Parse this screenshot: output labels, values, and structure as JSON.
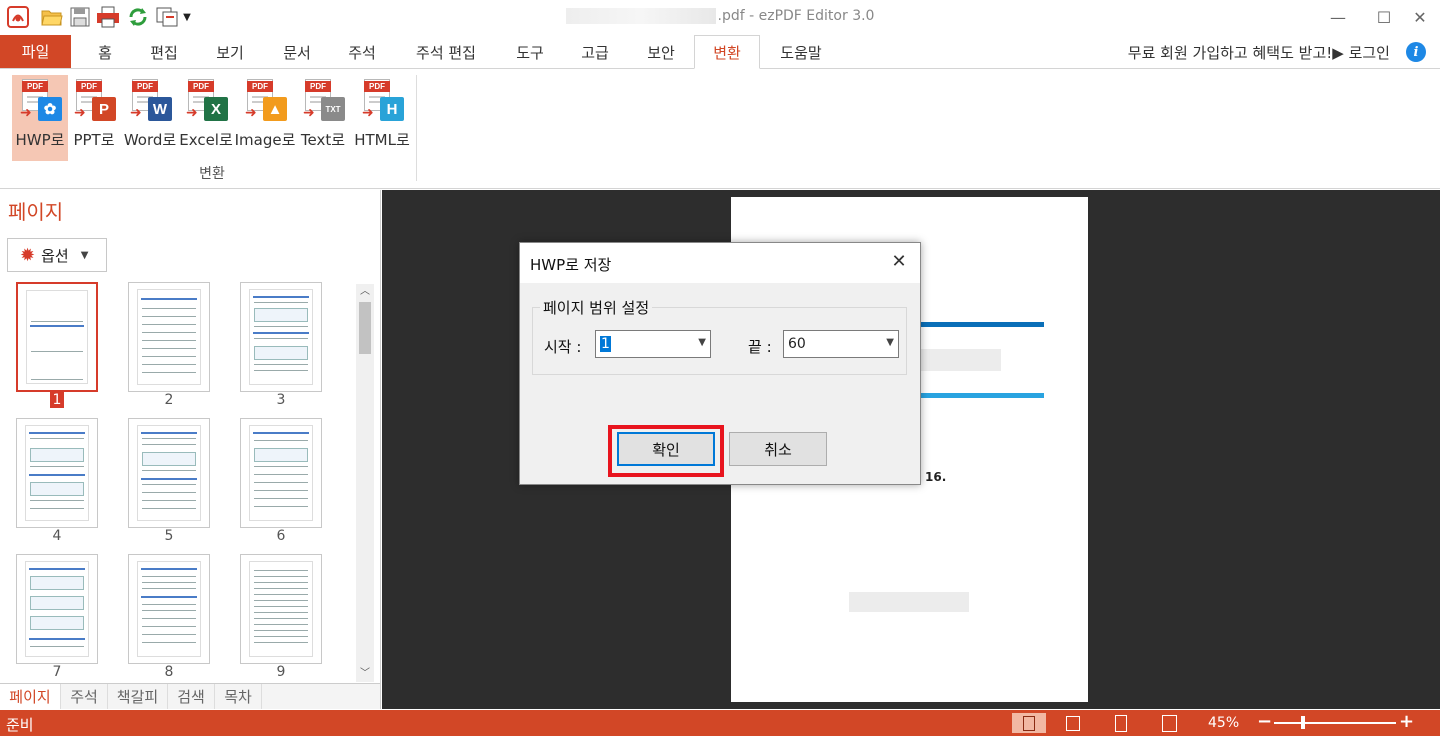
{
  "window": {
    "title_suffix": ".pdf - ezPDF Editor 3.0",
    "minimize": "—",
    "maximize": "☐",
    "close": "✕"
  },
  "menu": {
    "file": "파일",
    "tabs": [
      "홈",
      "편집",
      "보기",
      "문서",
      "주석",
      "주석 편집",
      "도구",
      "고급",
      "보안",
      "변환",
      "도움말"
    ],
    "active_tab": "변환",
    "promo": "무료 회원 가입하고 혜택도 받고!▶ 로그인",
    "info": "i"
  },
  "ribbon": {
    "buttons": [
      {
        "label": "HWP로",
        "target": "hwp-icon",
        "badge": "✿",
        "color": "#1e88e5",
        "selected": true
      },
      {
        "label": "PPT로",
        "target": "ppt-icon",
        "badge": "P",
        "color": "#d24726",
        "selected": false
      },
      {
        "label": "Word로",
        "target": "word-icon",
        "badge": "W",
        "color": "#2b579a",
        "selected": false
      },
      {
        "label": "Excel로",
        "target": "excel-icon",
        "badge": "X",
        "color": "#217346",
        "selected": false
      },
      {
        "label": "Image로",
        "target": "image-icon",
        "badge": "▲",
        "color": "#f29b1d",
        "selected": false
      },
      {
        "label": "Text로",
        "target": "text-icon",
        "badge": "TXT",
        "color": "#8a8a8a",
        "selected": false
      },
      {
        "label": "HTML로",
        "target": "html-icon",
        "badge": "H",
        "color": "#29a3d8",
        "selected": false
      }
    ],
    "pdf_badge": "PDF",
    "group_label": "변환"
  },
  "left_panel": {
    "title": "페이지",
    "options_label": "옵션",
    "pages": [
      "1",
      "2",
      "3",
      "4",
      "5",
      "6",
      "7",
      "8",
      "9"
    ],
    "selected_page": "1",
    "bottom_tabs": [
      "페이지",
      "주석",
      "책갈피",
      "검색",
      "목차"
    ],
    "active_bottom_tab": "페이지"
  },
  "document": {
    "visible_number": "16."
  },
  "dialog": {
    "title": "HWP로 저장",
    "group_label": "페이지 범위 설정",
    "start_label": "시작 :",
    "start_value": "1",
    "end_label": "끝 :",
    "end_value": "60",
    "ok_label": "확인",
    "cancel_label": "취소"
  },
  "status": {
    "text": "준비",
    "zoom": "45%",
    "zoom_level": 0.24,
    "zoom_minus": "−",
    "zoom_plus": "+"
  },
  "colors": {
    "accent": "#d24726",
    "highlight": "#e8141e",
    "selection": "#0078d7"
  }
}
